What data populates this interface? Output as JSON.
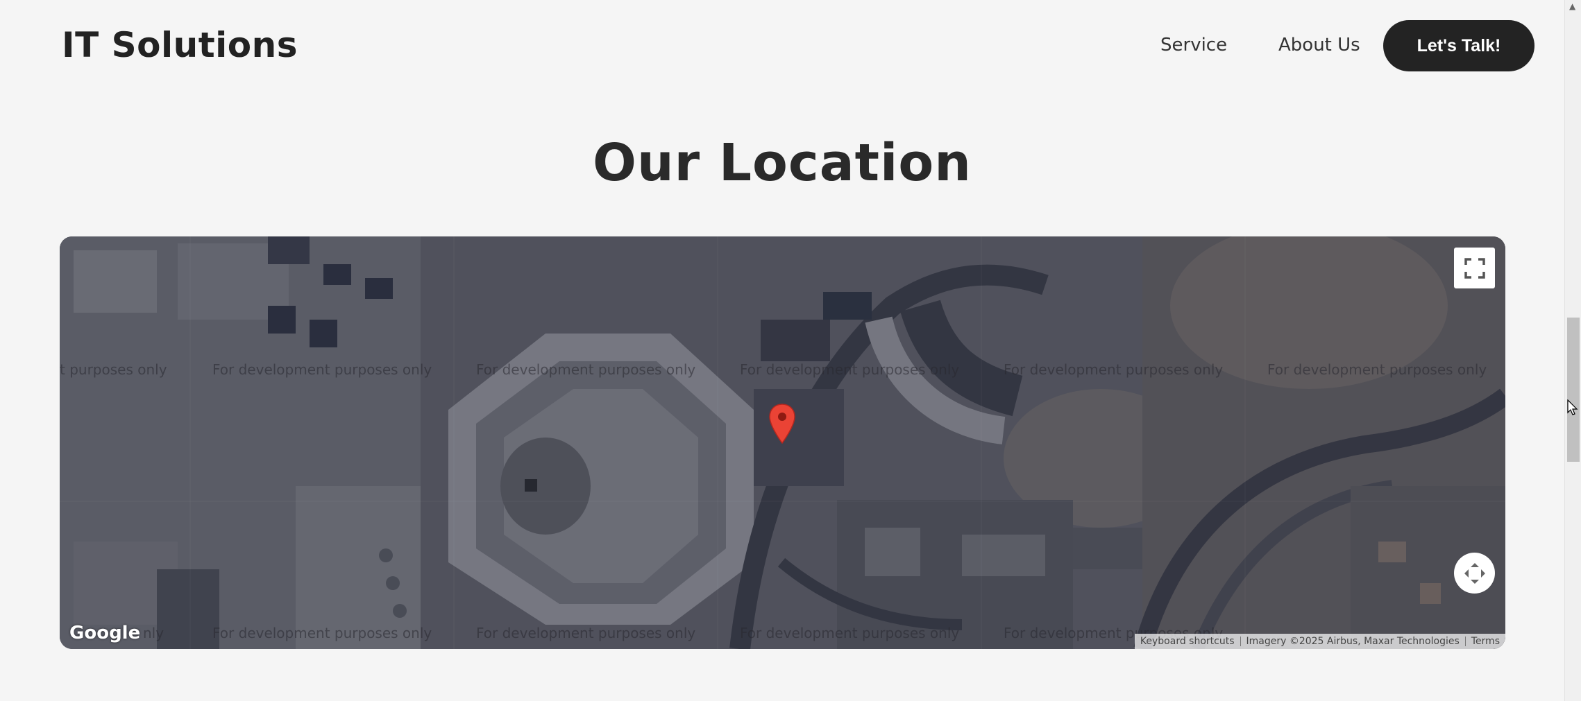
{
  "header": {
    "brand": "IT Solutions",
    "nav": [
      {
        "label": "Service"
      },
      {
        "label": "About Us"
      }
    ],
    "cta_label": "Let's Talk!"
  },
  "section": {
    "title": "Our Location"
  },
  "map": {
    "watermark": "For development purposes only",
    "watermark_partial_start": "t purposes only",
    "watermark_partial_bottom": "nly",
    "google_logo": "Google",
    "attribution": {
      "shortcuts": "Keyboard shortcuts",
      "imagery": "Imagery ©2025 Airbus, Maxar Technologies",
      "terms": "Terms"
    },
    "fullscreen_icon": "fullscreen-icon",
    "camera_icon": "camera-control-icon",
    "marker_icon": "map-pin-icon",
    "marker_color": "#ea4335"
  },
  "colors": {
    "cta_bg": "#232323",
    "page_bg": "#f5f5f5"
  }
}
